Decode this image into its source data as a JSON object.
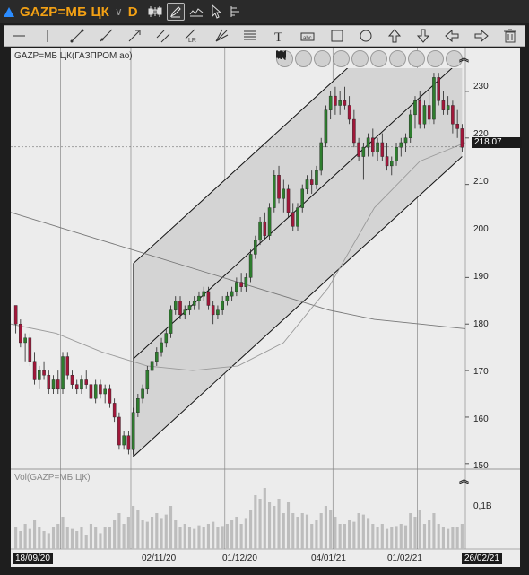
{
  "title_bar": {
    "symbol": "GAZP=МБ ЦК",
    "period": "D"
  },
  "toolbar_icons": [
    "candles-icon",
    "draw-cursor-icon",
    "indicator-icon",
    "pointer-icon",
    "scale-icon"
  ],
  "draw_tools": [
    "horizontal-line-icon",
    "vertical-line-icon",
    "segment-icon",
    "ray-icon",
    "arrow-icon",
    "parallel-lines-icon",
    "regression-channel-icon",
    "fork-icon",
    "fibo-levels-icon",
    "text-icon",
    "label-icon",
    "rectangle-icon",
    "ellipse-icon",
    "arrow-up-icon",
    "arrow-down-icon",
    "arrow-left-icon",
    "arrow-right-icon",
    "trash-icon"
  ],
  "price_pane": {
    "label": "GAZP=МБ ЦК(ГАЗПРОМ ао)",
    "y_ticks": [
      "230",
      "220",
      "210",
      "200",
      "190",
      "180",
      "170",
      "160",
      "150"
    ],
    "last_price": "218.07"
  },
  "volume_pane": {
    "label": "Vol(GAZP=МБ ЦК)",
    "tick": "0,1B"
  },
  "x_axis": {
    "start": "18/09/20",
    "ticks": [
      "02/11/20",
      "01/12/20",
      "04/01/21",
      "01/02/21"
    ],
    "end": "26/02/21"
  },
  "chart_data": {
    "type": "candlestick",
    "ylim": [
      149,
      235
    ],
    "candles": [
      [
        184,
        184,
        178,
        180
      ],
      [
        180,
        181,
        175,
        176
      ],
      [
        176,
        178,
        172,
        177
      ],
      [
        177,
        178,
        171,
        172
      ],
      [
        172,
        174,
        167,
        168
      ],
      [
        168,
        171,
        166,
        170
      ],
      [
        170,
        172,
        168,
        169
      ],
      [
        169,
        170,
        165,
        166
      ],
      [
        166,
        169,
        165,
        168
      ],
      [
        168,
        170,
        165,
        166
      ],
      [
        166,
        174,
        165,
        173
      ],
      [
        173,
        174,
        168,
        169
      ],
      [
        169,
        170,
        166,
        167
      ],
      [
        167,
        168,
        165,
        166
      ],
      [
        166,
        169,
        165,
        168
      ],
      [
        168,
        170,
        166,
        167
      ],
      [
        167,
        168,
        163,
        164
      ],
      [
        164,
        168,
        163,
        167
      ],
      [
        167,
        168,
        164,
        165
      ],
      [
        165,
        167,
        163,
        166
      ],
      [
        166,
        167,
        162,
        163
      ],
      [
        163,
        164,
        159,
        160
      ],
      [
        160,
        161,
        153,
        154
      ],
      [
        154,
        157,
        153,
        156
      ],
      [
        156,
        157,
        152,
        153
      ],
      [
        153,
        162,
        152,
        161
      ],
      [
        161,
        165,
        160,
        164
      ],
      [
        164,
        167,
        163,
        166
      ],
      [
        166,
        171,
        165,
        170
      ],
      [
        170,
        173,
        169,
        172
      ],
      [
        172,
        175,
        171,
        174
      ],
      [
        174,
        177,
        173,
        176
      ],
      [
        176,
        179,
        175,
        178
      ],
      [
        178,
        184,
        177,
        183
      ],
      [
        183,
        186,
        182,
        185
      ],
      [
        185,
        186,
        181,
        182
      ],
      [
        182,
        184,
        181,
        183
      ],
      [
        183,
        185,
        182,
        184
      ],
      [
        184,
        186,
        183,
        185
      ],
      [
        185,
        187,
        183,
        186
      ],
      [
        186,
        188,
        185,
        187
      ],
      [
        187,
        188,
        183,
        184
      ],
      [
        184,
        185,
        180,
        182
      ],
      [
        182,
        184,
        181,
        183
      ],
      [
        183,
        186,
        182,
        185
      ],
      [
        185,
        187,
        184,
        186
      ],
      [
        186,
        188,
        185,
        187
      ],
      [
        187,
        190,
        186,
        189
      ],
      [
        189,
        191,
        187,
        188
      ],
      [
        188,
        191,
        187,
        190
      ],
      [
        190,
        196,
        189,
        195
      ],
      [
        195,
        199,
        194,
        198
      ],
      [
        198,
        203,
        197,
        202
      ],
      [
        202,
        204,
        198,
        199
      ],
      [
        199,
        206,
        198,
        205
      ],
      [
        205,
        213,
        204,
        212
      ],
      [
        212,
        214,
        206,
        207
      ],
      [
        207,
        211,
        204,
        209
      ],
      [
        209,
        210,
        203,
        204
      ],
      [
        204,
        206,
        200,
        201
      ],
      [
        201,
        206,
        200,
        205
      ],
      [
        205,
        210,
        204,
        209
      ],
      [
        209,
        212,
        208,
        211
      ],
      [
        211,
        213,
        208,
        210
      ],
      [
        210,
        214,
        209,
        213
      ],
      [
        213,
        220,
        212,
        219
      ],
      [
        219,
        227,
        218,
        226
      ],
      [
        226,
        230,
        224,
        229
      ],
      [
        229,
        231,
        225,
        227
      ],
      [
        227,
        230,
        225,
        228
      ],
      [
        228,
        231,
        226,
        227
      ],
      [
        227,
        229,
        223,
        224
      ],
      [
        224,
        226,
        218,
        219
      ],
      [
        219,
        220,
        215,
        216
      ],
      [
        216,
        219,
        211,
        218
      ],
      [
        218,
        221,
        216,
        220
      ],
      [
        220,
        222,
        216,
        217
      ],
      [
        217,
        220,
        215,
        219
      ],
      [
        219,
        221,
        215,
        216
      ],
      [
        216,
        219,
        213,
        214
      ],
      [
        214,
        216,
        212,
        215
      ],
      [
        215,
        219,
        214,
        218
      ],
      [
        218,
        220,
        216,
        219
      ],
      [
        219,
        221,
        217,
        220
      ],
      [
        220,
        226,
        219,
        225
      ],
      [
        225,
        229,
        222,
        228
      ],
      [
        228,
        230,
        222,
        223
      ],
      [
        223,
        228,
        222,
        227
      ],
      [
        227,
        230,
        223,
        224
      ],
      [
        224,
        234,
        223,
        233
      ],
      [
        233,
        234,
        227,
        228
      ],
      [
        228,
        230,
        225,
        226
      ],
      [
        226,
        229,
        225,
        227
      ],
      [
        227,
        228,
        221,
        223
      ],
      [
        223,
        226,
        220,
        222
      ],
      [
        222,
        223,
        217,
        218
      ]
    ],
    "volume_units": "relative",
    "volume": [
      0.3,
      0.25,
      0.35,
      0.28,
      0.4,
      0.3,
      0.25,
      0.22,
      0.3,
      0.35,
      0.45,
      0.3,
      0.28,
      0.25,
      0.3,
      0.2,
      0.35,
      0.3,
      0.22,
      0.3,
      0.3,
      0.4,
      0.5,
      0.35,
      0.45,
      0.6,
      0.55,
      0.4,
      0.38,
      0.45,
      0.5,
      0.42,
      0.48,
      0.6,
      0.4,
      0.3,
      0.35,
      0.3,
      0.28,
      0.33,
      0.3,
      0.35,
      0.38,
      0.3,
      0.32,
      0.35,
      0.4,
      0.45,
      0.35,
      0.42,
      0.55,
      0.75,
      0.7,
      0.85,
      0.65,
      0.6,
      0.7,
      0.5,
      0.65,
      0.5,
      0.45,
      0.5,
      0.48,
      0.35,
      0.4,
      0.5,
      0.6,
      0.55,
      0.45,
      0.35,
      0.35,
      0.4,
      0.38,
      0.5,
      0.48,
      0.42,
      0.35,
      0.3,
      0.35,
      0.28,
      0.3,
      0.32,
      0.35,
      0.33,
      0.5,
      0.45,
      0.55,
      0.35,
      0.4,
      0.5,
      0.35,
      0.3,
      0.28,
      0.3,
      0.3,
      0.35
    ],
    "channel": {
      "lower": [
        [
          25,
          151.5
        ],
        [
          95,
          216
        ]
      ],
      "middle": [
        [
          25,
          172.5
        ],
        [
          95,
          237
        ]
      ],
      "upper": [
        [
          25,
          193
        ],
        [
          95,
          257.5
        ]
      ]
    },
    "ma_slow": [
      204,
      201,
      198,
      195,
      192,
      189,
      186,
      183,
      181,
      180,
      179
    ],
    "ma_fast": [
      180,
      178,
      174,
      171,
      170,
      171,
      176,
      188,
      205,
      215,
      219
    ]
  }
}
